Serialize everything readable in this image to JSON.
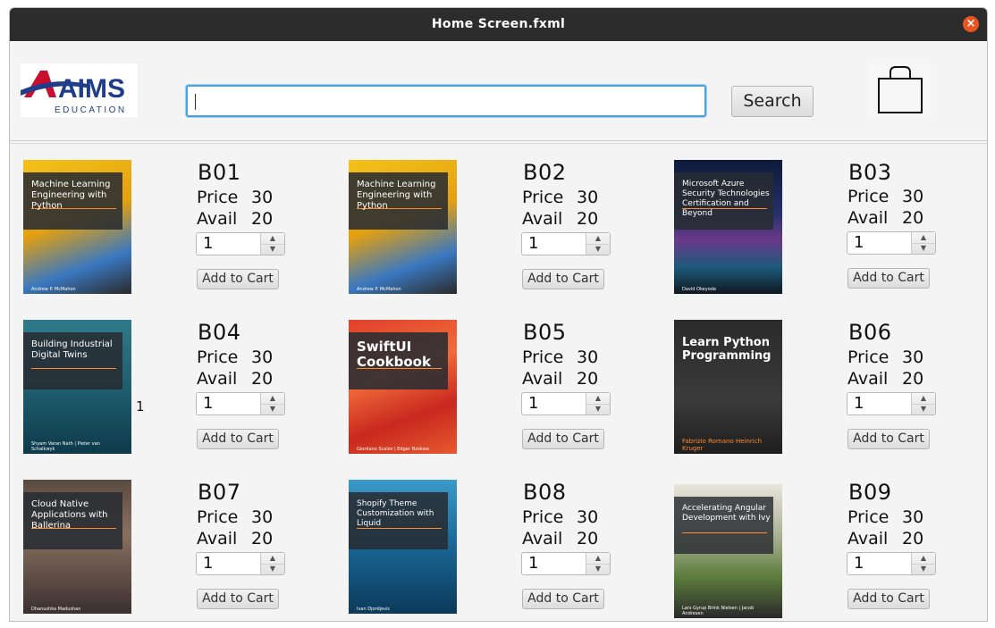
{
  "window": {
    "title": "Home Screen.fxml"
  },
  "header": {
    "logo_text": "AIMS",
    "logo_sub": "EDUCATION",
    "search": {
      "value": "",
      "placeholder": ""
    },
    "search_label": "Search"
  },
  "labels": {
    "price": "Price",
    "avail": "Avail",
    "add_to_cart": "Add to Cart"
  },
  "books": [
    {
      "code": "B01",
      "price": "30",
      "avail": "20",
      "qty": "1",
      "cover_title": "Machine Learning Engineering with Python",
      "cover_author": "Andrew P. McMahon"
    },
    {
      "code": "B02",
      "price": "30",
      "avail": "20",
      "qty": "1",
      "cover_title": "Machine Learning Engineering with Python",
      "cover_author": "Andrew P. McMahon"
    },
    {
      "code": "B03",
      "price": "30",
      "avail": "20",
      "qty": "1",
      "cover_title": "Microsoft Azure Security Technologies Certification and Beyond",
      "cover_author": "David Okeyode"
    },
    {
      "code": "B04",
      "price": "30",
      "avail": "20",
      "qty": "1",
      "cover_title": "Building Industrial Digital Twins",
      "cover_author": "Shyam Varan Nath | Pieter van Schalkwyk"
    },
    {
      "code": "B05",
      "price": "30",
      "avail": "20",
      "qty": "1",
      "cover_title": "SwiftUI Cookbook",
      "cover_author": "Giordano Scalzo | Edgar Nzokwe"
    },
    {
      "code": "B06",
      "price": "30",
      "avail": "20",
      "qty": "1",
      "cover_title": "Learn Python Programming",
      "cover_author": "Fabrizio Romano Heinrich Kruger"
    },
    {
      "code": "B07",
      "price": "30",
      "avail": "20",
      "qty": "1",
      "cover_title": "Cloud Native Applications with Ballerina",
      "cover_author": "Dhanushka Madushan"
    },
    {
      "code": "B08",
      "price": "30",
      "avail": "20",
      "qty": "1",
      "cover_title": "Shopify Theme Customization with Liquid",
      "cover_author": "Ivan Djordjevic"
    },
    {
      "code": "B09",
      "price": "30",
      "avail": "20",
      "qty": "1",
      "cover_title": "Accelerating Angular Development with Ivy",
      "cover_author": "Lars Gyrup Brink Nielsen | Jacob Andresen"
    }
  ],
  "stray_text": "1",
  "colors": {
    "titlebar": "#2c2c2c",
    "close": "#e95420",
    "focus": "#4aa3df",
    "brand_red": "#c8102e",
    "brand_blue": "#1f3d8a"
  }
}
